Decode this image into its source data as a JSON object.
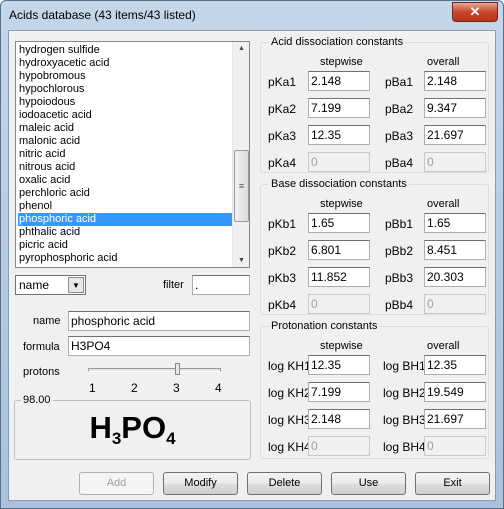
{
  "window": {
    "title": "Acids database (43 items/43 listed)",
    "close_icon": "close-icon"
  },
  "list": {
    "items": [
      "hydrogen sulfide",
      "hydroxyacetic acid",
      "hypobromous",
      "hypochlorous",
      "hypoiodous",
      "iodoacetic acid",
      "maleic acid",
      "malonic acid",
      "nitric acid",
      "nitrous acid",
      "oxalic acid",
      "perchloric acid",
      "phenol",
      "phosphoric acid",
      "phthalic acid",
      "picric acid",
      "pyrophosphoric acid"
    ],
    "selected": "phosphoric acid"
  },
  "sort": {
    "value": "name"
  },
  "filter": {
    "label": "filter",
    "value": "."
  },
  "name": {
    "label": "name",
    "value": "phosphoric acid"
  },
  "formula": {
    "label": "formula",
    "value": "H3PO4"
  },
  "protons": {
    "label": "protons",
    "ticks": [
      "1",
      "2",
      "3",
      "4"
    ],
    "value": 3
  },
  "molar_mass": {
    "label": "98.00",
    "display": {
      "h": "H",
      "n1": "3",
      "po": "PO",
      "n2": "4"
    }
  },
  "groups": [
    {
      "title": "Acid dissociation constants",
      "col1": "stepwise",
      "col2": "overall",
      "rows": [
        {
          "l1": "pKa1",
          "v1": "2.148",
          "l2": "pBa1",
          "v2": "2.148",
          "disabled": false
        },
        {
          "l1": "pKa2",
          "v1": "7.199",
          "l2": "pBa2",
          "v2": "9.347",
          "disabled": false
        },
        {
          "l1": "pKa3",
          "v1": "12.35",
          "l2": "pBa3",
          "v2": "21.697",
          "disabled": false
        },
        {
          "l1": "pKa4",
          "v1": "0",
          "l2": "pBa4",
          "v2": "0",
          "disabled": true
        }
      ]
    },
    {
      "title": "Base dissociation constants",
      "col1": "stepwise",
      "col2": "overall",
      "rows": [
        {
          "l1": "pKb1",
          "v1": "1.65",
          "l2": "pBb1",
          "v2": "1.65",
          "disabled": false
        },
        {
          "l1": "pKb2",
          "v1": "6.801",
          "l2": "pBb2",
          "v2": "8.451",
          "disabled": false
        },
        {
          "l1": "pKb3",
          "v1": "11.852",
          "l2": "pBb3",
          "v2": "20.303",
          "disabled": false
        },
        {
          "l1": "pKb4",
          "v1": "0",
          "l2": "pBb4",
          "v2": "0",
          "disabled": true
        }
      ]
    },
    {
      "title": "Protonation constants",
      "col1": "stepwise",
      "col2": "overall",
      "rows": [
        {
          "l1": "log KH1",
          "v1": "12.35",
          "l2": "log BH1",
          "v2": "12.35",
          "disabled": false
        },
        {
          "l1": "log KH2",
          "v1": "7.199",
          "l2": "log BH2",
          "v2": "19.549",
          "disabled": false
        },
        {
          "l1": "log KH3",
          "v1": "2.148",
          "l2": "log BH3",
          "v2": "21.697",
          "disabled": false
        },
        {
          "l1": "log KH4",
          "v1": "0",
          "l2": "log BH4",
          "v2": "0",
          "disabled": true
        }
      ]
    }
  ],
  "buttons": [
    {
      "label": "Add",
      "disabled": true
    },
    {
      "label": "Modify",
      "disabled": false
    },
    {
      "label": "Delete",
      "disabled": false
    },
    {
      "label": "Use",
      "disabled": false
    },
    {
      "label": "Exit",
      "disabled": false
    }
  ],
  "colors": {
    "selection": "#3399ff",
    "close": "#c9462c"
  }
}
